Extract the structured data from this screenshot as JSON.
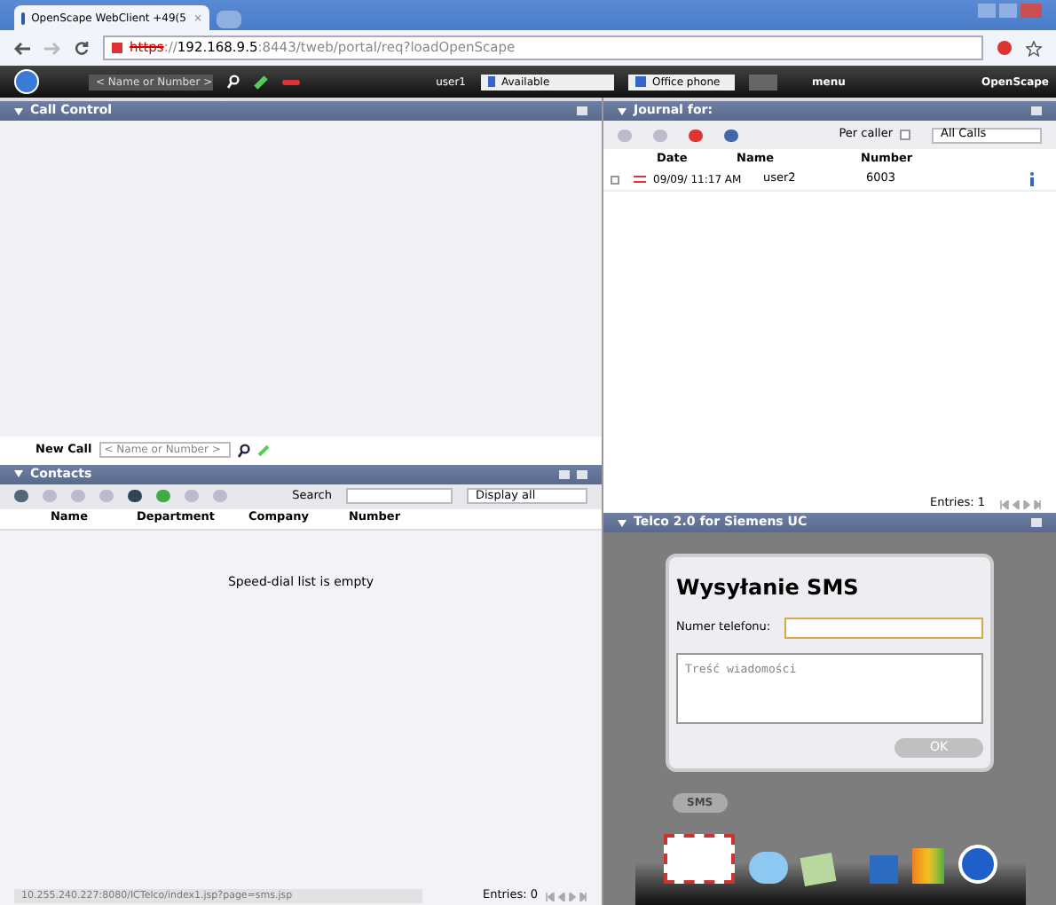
{
  "browser": {
    "tab_title": "OpenScape WebClient +49(5",
    "tab_close": "×",
    "url_scheme": "https",
    "url_sep": "://",
    "url_host": "192.168.9.5",
    "url_rest": ":8443/tweb/portal/req?loadOpenScape"
  },
  "app_bar": {
    "search_placeholder": "< Name or Number >",
    "user": "user1",
    "status": "Available",
    "device": "Office phone",
    "menu": "menu",
    "brand": "OpenScape"
  },
  "call_control": {
    "title": "Call Control"
  },
  "new_call": {
    "label": "New Call",
    "placeholder": "< Name or Number >"
  },
  "contacts": {
    "title": "Contacts",
    "search_label": "Search",
    "filter": "Display all",
    "columns": [
      "Name",
      "Department",
      "Company",
      "Number"
    ],
    "empty": "Speed-dial list is empty",
    "entries": "Entries: 0"
  },
  "status_bar": {
    "url": "10.255.240.227:8080/ICTelco/index1.jsp?page=sms.jsp"
  },
  "journal": {
    "title": "Journal for:",
    "per_caller": {
      "label": "Per caller",
      "checked": false
    },
    "filter": "All Calls",
    "columns": [
      "Date",
      "Name",
      "Number"
    ],
    "rows": [
      {
        "checked": false,
        "date": "09/09/ 11:17 AM",
        "name": "user2",
        "number": "6003"
      }
    ],
    "entries": "Entries: 1"
  },
  "telco": {
    "title": "Telco 2.0 for Siemens UC",
    "dialog_title": "Wysyłanie SMS",
    "phone_label": "Numer telefonu:",
    "message_placeholder": "Treść wiadomości",
    "ok": "OK",
    "sms_label": "SMS"
  }
}
